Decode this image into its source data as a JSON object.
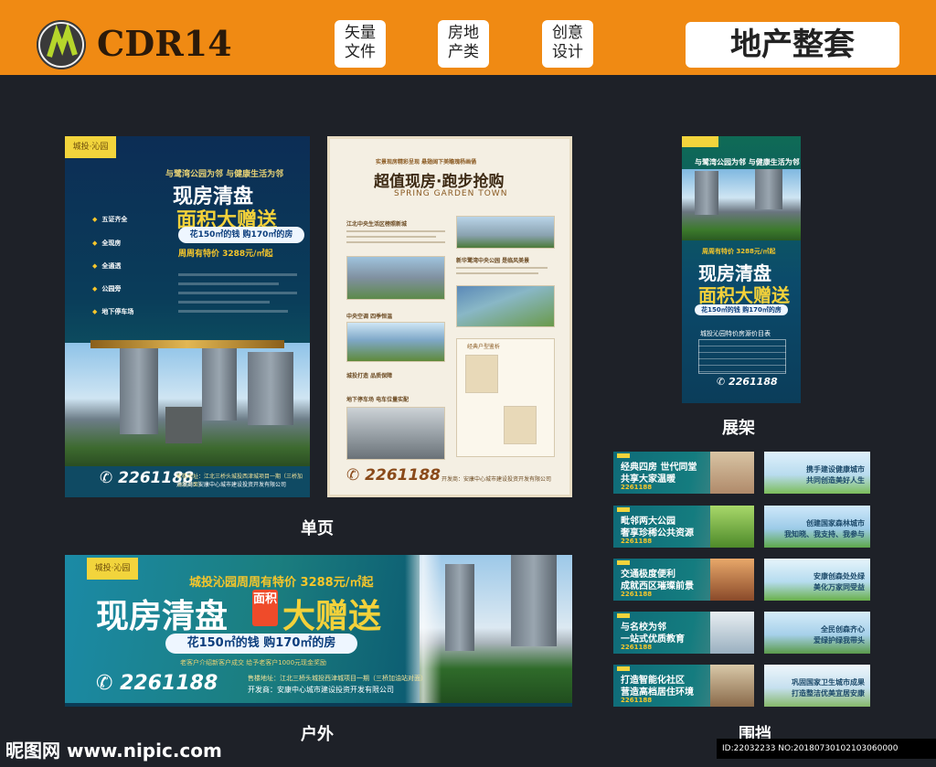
{
  "header": {
    "title": "CDR14",
    "tags": [
      "矢量\n文件",
      "房地\n产类",
      "创意\n设计"
    ],
    "badge": "地产整套"
  },
  "labels": {
    "single_page": "单页",
    "stand": "展架",
    "outdoor": "户外",
    "hoarding": "围挡"
  },
  "poster1": {
    "brand": "城投·沁园",
    "sub": "与鹭湾公园为邻 与健康生活为邻",
    "headline1": "现房清盘",
    "headline2": "面积大赠送",
    "pill": "花150㎡的钱 购170㎡的房",
    "price": "周周有特价 3288元/㎡起",
    "features": [
      "五证齐全",
      "全现房",
      "全通透",
      "公园旁",
      "地下停车场"
    ],
    "phone": "2261188",
    "addr": "售楼地址：江北三桥头城投西津城项目一期（三桥加油站对面）",
    "dev": "开发商：安康中心城市建设投资开发有限公司"
  },
  "poster2": {
    "top": "实景现房精彩呈现 悬翅阔下美瞻瑰杨画俑",
    "title": "超值现房·跑步抢购",
    "english": "SPRING GARDEN TOWN",
    "sections": [
      "江北中央生活区榜照新城",
      "新华鹭湾中央公园 是临风美景",
      "中央空调 四季恒温",
      "城投打造 品质保障",
      "地下停车场 电车位量实配"
    ],
    "floorplan_title": "经典户型鉴析",
    "phone": "2261188",
    "dev": "开发商：安康中心城市建设投资开发有限公司"
  },
  "stand": {
    "sub": "与鹭湾公园为邻 与健康生活为邻",
    "price": "周周有特价 3288元/㎡起",
    "headline1": "现房清盘",
    "headline2": "面积大赠送",
    "pill": "花150㎡的钱 购170㎡的房",
    "table_title": "城投沁园特价房源价目表",
    "phone": "2261188"
  },
  "outdoor": {
    "brand": "城投·沁园",
    "sub": "城投沁园周周有特价 3288元/㎡起",
    "headline1": "现房清盘",
    "box": "面积",
    "headline2": "大赠送",
    "pill": "花150㎡的钱 购170㎡的房",
    "note": "老客户介绍新客户成交 给予老客户1000元现金奖励",
    "phone": "2261188",
    "addr": "售楼地址：江北三桥头城投西津城项目一期（三桥加油站对面）",
    "dev": "开发商：安康中心城市建设投资开发有限公司"
  },
  "hoardings_left": [
    {
      "l1": "经典四房 世代同堂",
      "l2": "共享大家温暖",
      "phone": "2261188"
    },
    {
      "l1": "毗邻两大公园",
      "l2": "奢享珍稀公共资源",
      "phone": "2261188"
    },
    {
      "l1": "交通极度便利",
      "l2": "成就西区璀璨前景",
      "phone": "2261188"
    },
    {
      "l1": "与名校为邻",
      "l2": "一站式优质教育",
      "phone": "2261188"
    },
    {
      "l1": "打造智能化社区",
      "l2": "营造高档居住环境",
      "phone": "2261188"
    }
  ],
  "hoardings_right": [
    {
      "l1": "携手建设健康城市",
      "l2": "共同创造美好人生"
    },
    {
      "l1": "创建国家森林城市",
      "l2": "我知晓、我支持、我参与"
    },
    {
      "l1": "安康创森处处绿",
      "l2": "美化万家同受益"
    },
    {
      "l1": "全民创森齐心",
      "l2": "爱绿护绿我带头"
    },
    {
      "l1": "巩固国家卫生城市成果",
      "l2": "打造整洁优美宜居安康"
    }
  ],
  "footer": {
    "watermark": "昵图网 www.nipic.com",
    "id": "ID:22032233 NO:20180730102103060000"
  },
  "colors": {
    "header": "#f08a13",
    "background": "#1e2128",
    "gold": "#f6c62b"
  }
}
